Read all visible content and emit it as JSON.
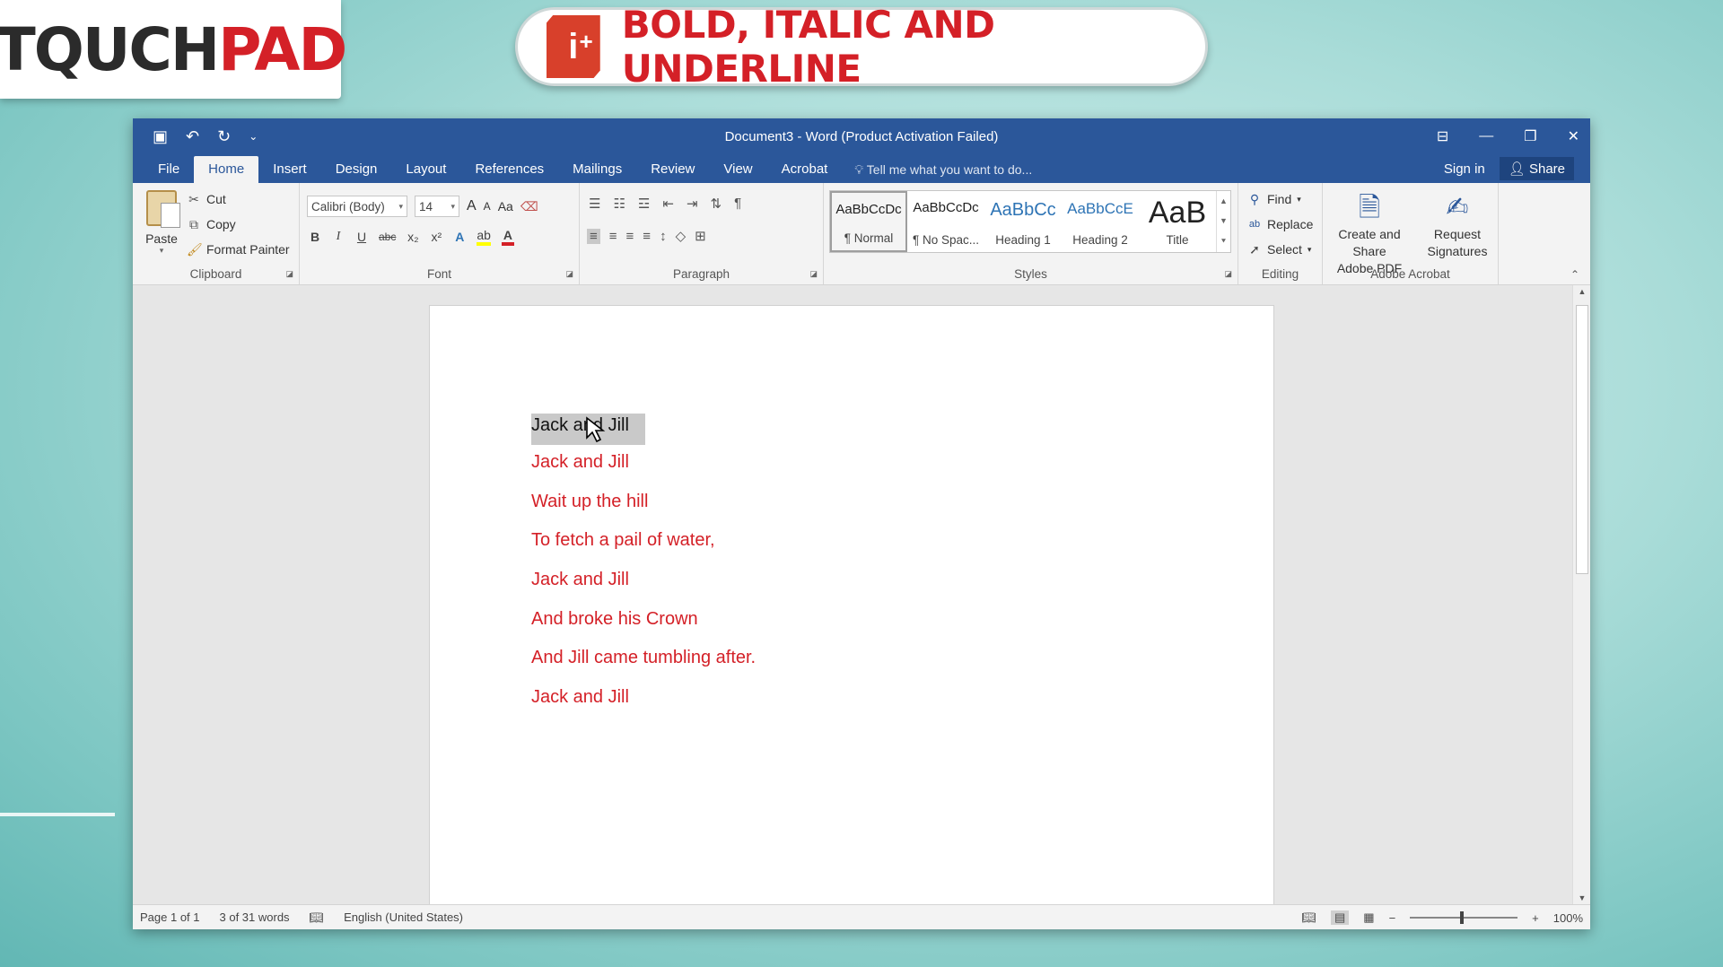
{
  "branding": {
    "logo_left": "TQUCH",
    "logo_right": "PAD",
    "lesson_title": "BOLD, ITALIC AND UNDERLINE",
    "lesson_icon_letter": "i",
    "lesson_icon_plus": "+"
  },
  "word": {
    "title": "Document3 - Word (Product Activation Failed)",
    "qat": [
      "save-icon",
      "undo-icon",
      "redo-icon",
      "customize-icon"
    ],
    "tabs": [
      "File",
      "Home",
      "Insert",
      "Design",
      "Layout",
      "References",
      "Mailings",
      "Review",
      "View",
      "Acrobat"
    ],
    "active_tab": "Home",
    "tell_me": "Tell me what you want to do...",
    "sign_in": "Sign in",
    "share": "Share",
    "clipboard": {
      "paste": "Paste",
      "cut": "Cut",
      "copy": "Copy",
      "format_painter": "Format Painter",
      "label": "Clipboard"
    },
    "font": {
      "family": "Calibri (Body)",
      "size": "14",
      "grow": "A",
      "shrink": "A",
      "change_case": "Aa",
      "bold": "B",
      "italic": "I",
      "underline": "U",
      "strike": "abc",
      "subscript": "x₂",
      "superscript": "x²",
      "label": "Font"
    },
    "paragraph": {
      "label": "Paragraph"
    },
    "styles": {
      "items": [
        {
          "preview": "AaBbCcDc",
          "name": "¶ Normal"
        },
        {
          "preview": "AaBbCcDc",
          "name": "¶ No Spac..."
        },
        {
          "preview": "AaBbCc",
          "name": "Heading 1"
        },
        {
          "preview": "AaBbCcE",
          "name": "Heading 2"
        },
        {
          "preview": "AaB",
          "name": "Title"
        }
      ],
      "label": "Styles"
    },
    "editing": {
      "find": "Find",
      "replace": "Replace",
      "select": "Select",
      "label": "Editing"
    },
    "acrobat": {
      "create_share_1": "Create and Share",
      "create_share_2": "Adobe PDF",
      "request_1": "Request",
      "request_2": "Signatures",
      "label": "Adobe Acrobat"
    },
    "document_lines": [
      "Jack and Jill",
      "Jack and Jill",
      "Wait up the hill",
      "To fetch a pail of water,",
      "Jack and Jill",
      "And broke his Crown",
      "And Jill came tumbling after.",
      "Jack and Jill"
    ],
    "selected_line_index": 0,
    "status": {
      "page": "Page 1 of 1",
      "words": "3 of 31 words",
      "language": "English (United States)",
      "zoom": "100%"
    },
    "colors": {
      "title_bar": "#2b579a",
      "text_red": "#d42027",
      "selection": "#c9c9c9"
    }
  }
}
